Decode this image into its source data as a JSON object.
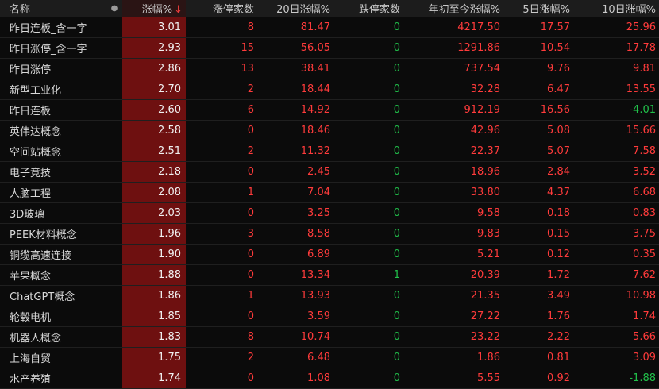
{
  "header": {
    "name": "名称",
    "dot": "●",
    "change_pct": "涨幅%",
    "sort_arrow": "↓",
    "limit_up_count": "涨停家数",
    "change_20d": "20日涨幅%",
    "limit_down_count": "跌停家数",
    "ytd_change": "年初至今涨幅%",
    "change_5d": "5日涨幅%",
    "change_10d": "10日涨幅%"
  },
  "rows": [
    {
      "name": "昨日连板_含一字",
      "chg": "3.01",
      "up": "8",
      "d20": "81.47",
      "down": "0",
      "ytd": "4217.50",
      "d5": "17.57",
      "d10": "25.96"
    },
    {
      "name": "昨日涨停_含一字",
      "chg": "2.93",
      "up": "15",
      "d20": "56.05",
      "down": "0",
      "ytd": "1291.86",
      "d5": "10.54",
      "d10": "17.78"
    },
    {
      "name": "昨日涨停",
      "chg": "2.86",
      "up": "13",
      "d20": "38.41",
      "down": "0",
      "ytd": "737.54",
      "d5": "9.76",
      "d10": "9.81"
    },
    {
      "name": "新型工业化",
      "chg": "2.70",
      "up": "2",
      "d20": "18.44",
      "down": "0",
      "ytd": "32.28",
      "d5": "6.47",
      "d10": "13.55"
    },
    {
      "name": "昨日连板",
      "chg": "2.60",
      "up": "6",
      "d20": "14.92",
      "down": "0",
      "ytd": "912.19",
      "d5": "16.56",
      "d10": "-4.01"
    },
    {
      "name": "英伟达概念",
      "chg": "2.58",
      "up": "0",
      "d20": "18.46",
      "down": "0",
      "ytd": "42.96",
      "d5": "5.08",
      "d10": "15.66"
    },
    {
      "name": "空间站概念",
      "chg": "2.51",
      "up": "2",
      "d20": "11.32",
      "down": "0",
      "ytd": "22.37",
      "d5": "5.07",
      "d10": "7.58"
    },
    {
      "name": "电子竞技",
      "chg": "2.18",
      "up": "0",
      "d20": "2.45",
      "down": "0",
      "ytd": "18.96",
      "d5": "2.84",
      "d10": "3.52"
    },
    {
      "name": "人脑工程",
      "chg": "2.08",
      "up": "1",
      "d20": "7.04",
      "down": "0",
      "ytd": "33.80",
      "d5": "4.37",
      "d10": "6.68"
    },
    {
      "name": "3D玻璃",
      "chg": "2.03",
      "up": "0",
      "d20": "3.25",
      "down": "0",
      "ytd": "9.58",
      "d5": "0.18",
      "d10": "0.83"
    },
    {
      "name": "PEEK材料概念",
      "chg": "1.96",
      "up": "3",
      "d20": "8.58",
      "down": "0",
      "ytd": "9.83",
      "d5": "0.15",
      "d10": "3.75"
    },
    {
      "name": "铜缆高速连接",
      "chg": "1.90",
      "up": "0",
      "d20": "6.89",
      "down": "0",
      "ytd": "5.21",
      "d5": "0.12",
      "d10": "0.35"
    },
    {
      "name": "苹果概念",
      "chg": "1.88",
      "up": "0",
      "d20": "13.34",
      "down": "1",
      "ytd": "20.39",
      "d5": "1.72",
      "d10": "7.62"
    },
    {
      "name": "ChatGPT概念",
      "chg": "1.86",
      "up": "1",
      "d20": "13.93",
      "down": "0",
      "ytd": "21.35",
      "d5": "3.49",
      "d10": "10.98"
    },
    {
      "name": "轮毂电机",
      "chg": "1.85",
      "up": "0",
      "d20": "3.59",
      "down": "0",
      "ytd": "27.22",
      "d5": "1.76",
      "d10": "1.74"
    },
    {
      "name": "机器人概念",
      "chg": "1.83",
      "up": "8",
      "d20": "10.74",
      "down": "0",
      "ytd": "23.22",
      "d5": "2.22",
      "d10": "5.66"
    },
    {
      "name": "上海自贸",
      "chg": "1.75",
      "up": "2",
      "d20": "6.48",
      "down": "0",
      "ytd": "1.86",
      "d5": "0.81",
      "d10": "3.09"
    },
    {
      "name": "水产养殖",
      "chg": "1.74",
      "up": "0",
      "d20": "1.08",
      "down": "0",
      "ytd": "5.55",
      "d5": "0.92",
      "d10": "-1.88"
    }
  ],
  "colors": {
    "up": "#ff3b3b",
    "down": "#21c04a",
    "highlight_column": "#6e1010",
    "background": "#0b0b0b"
  }
}
